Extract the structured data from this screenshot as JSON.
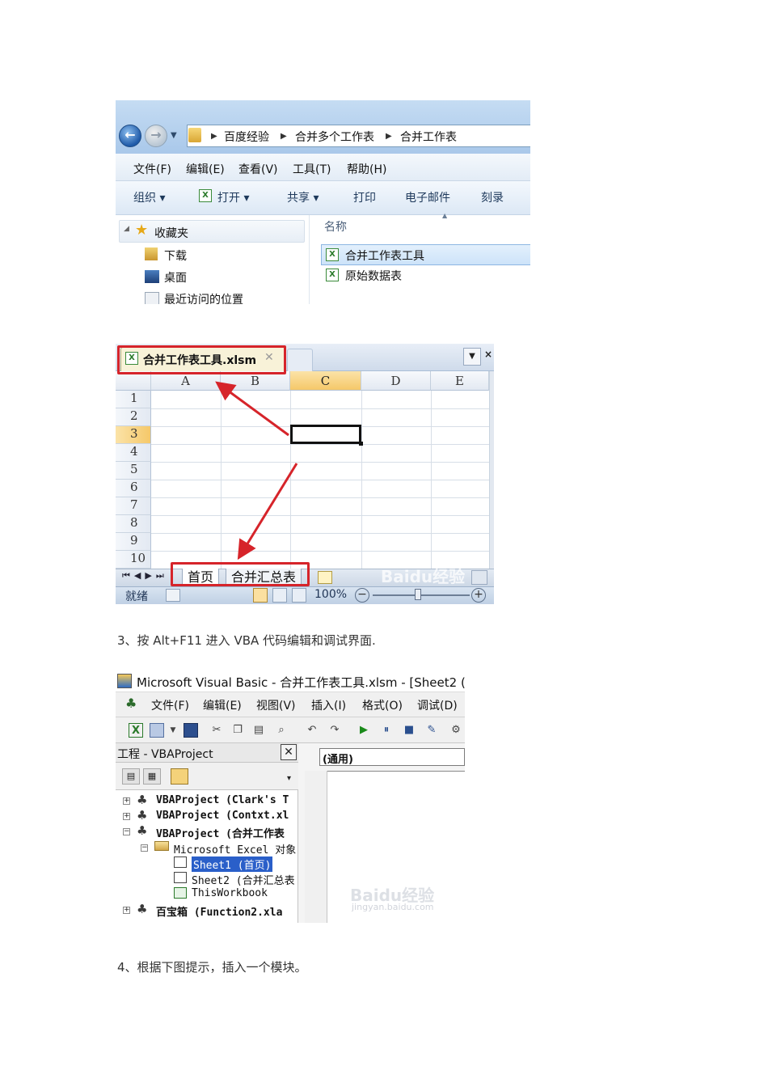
{
  "explorer": {
    "breadcrumb": [
      "百度经验",
      "合并多个工作表",
      "合并工作表"
    ],
    "menu": [
      "文件(F)",
      "编辑(E)",
      "查看(V)",
      "工具(T)",
      "帮助(H)"
    ],
    "toolbar": [
      "组织 ▾",
      "打开 ▾",
      "共享 ▾",
      "打印",
      "电子邮件",
      "刻录"
    ],
    "nav": {
      "favorites": "收藏夹",
      "items": [
        "下载",
        "桌面",
        "最近访问的位置"
      ]
    },
    "column_header": "名称",
    "files": [
      "合并工作表工具",
      "原始数据表"
    ]
  },
  "excel": {
    "file_tab": "合并工作表工具.xlsm",
    "columns": [
      "A",
      "B",
      "C",
      "D",
      "E"
    ],
    "rows": [
      "1",
      "2",
      "3",
      "4",
      "5",
      "6",
      "7",
      "8",
      "9",
      "10"
    ],
    "sheet_tabs": [
      "首页",
      "合并汇总表"
    ],
    "status": "就绪",
    "zoom": "100%",
    "watermark": "Baidu经验",
    "watermark_sub": "jingyan.baidu.com"
  },
  "step3": "3、按 Alt+F11 进入 VBA 代码编辑和调试界面.",
  "vbe": {
    "title": "Microsoft Visual Basic - 合并工作表工具.xlsm - [Sheet2 (代码",
    "menu": [
      "文件(F)",
      "编辑(E)",
      "视图(V)",
      "插入(I)",
      "格式(O)",
      "调试(D)"
    ],
    "project_title": "工程 - VBAProject",
    "tree": [
      "VBAProject (Clark's T",
      "VBAProject (Contxt.xl",
      "VBAProject (合并工作表",
      "Microsoft Excel 对象",
      "Sheet1 (首页)",
      "Sheet2 (合并汇总表",
      "ThisWorkbook",
      "百宝箱 (Function2.xla"
    ],
    "combo": "(通用)",
    "watermark": "Baidu经验",
    "watermark_sub": "jingyan.baidu.com"
  },
  "step4": "4、根据下图提示，插入一个模块。"
}
